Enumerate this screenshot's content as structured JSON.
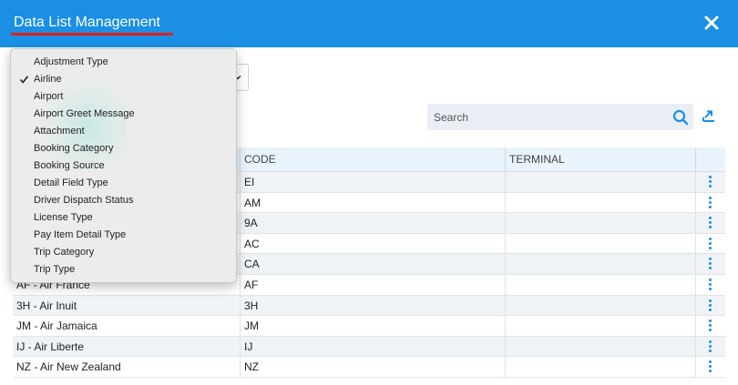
{
  "header": {
    "title": "Data List Management",
    "accent_color": "#1a8fe3",
    "underline_color": "#e01e1e",
    "close_icon": "close-icon"
  },
  "search": {
    "placeholder": "Search",
    "value": "",
    "icon": "search-icon"
  },
  "export": {
    "icon": "export-icon"
  },
  "dropdown": {
    "selected": "Airline",
    "items": [
      {
        "label": "Adjustment Type",
        "checked": false
      },
      {
        "label": "Airline",
        "checked": true
      },
      {
        "label": "Airport",
        "checked": false
      },
      {
        "label": "Airport Greet Message",
        "checked": false
      },
      {
        "label": "Attachment",
        "checked": false
      },
      {
        "label": "Booking Category",
        "checked": false
      },
      {
        "label": "Booking Source",
        "checked": false
      },
      {
        "label": "Detail Field Type",
        "checked": false
      },
      {
        "label": "Driver Dispatch Status",
        "checked": false
      },
      {
        "label": "License Type",
        "checked": false
      },
      {
        "label": "Pay Item Detail Type",
        "checked": false
      },
      {
        "label": "Trip Category",
        "checked": false
      },
      {
        "label": "Trip Type",
        "checked": false
      }
    ]
  },
  "table": {
    "columns": [
      "",
      "CODE",
      "TERMINAL",
      ""
    ],
    "rows": [
      {
        "name": "",
        "code": "EI",
        "terminal": ""
      },
      {
        "name": "",
        "code": "AM",
        "terminal": ""
      },
      {
        "name": "",
        "code": "9A",
        "terminal": ""
      },
      {
        "name": "",
        "code": "AC",
        "terminal": ""
      },
      {
        "name": "",
        "code": "CA",
        "terminal": ""
      },
      {
        "name": "AF - Air France",
        "code": "AF",
        "terminal": ""
      },
      {
        "name": "3H - Air Inuit",
        "code": "3H",
        "terminal": ""
      },
      {
        "name": "JM - Air Jamaica",
        "code": "JM",
        "terminal": ""
      },
      {
        "name": "IJ - Air Liberte",
        "code": "IJ",
        "terminal": ""
      },
      {
        "name": "NZ - Air New Zealand",
        "code": "NZ",
        "terminal": ""
      }
    ],
    "row_action_icon": "kebab-menu-icon"
  }
}
